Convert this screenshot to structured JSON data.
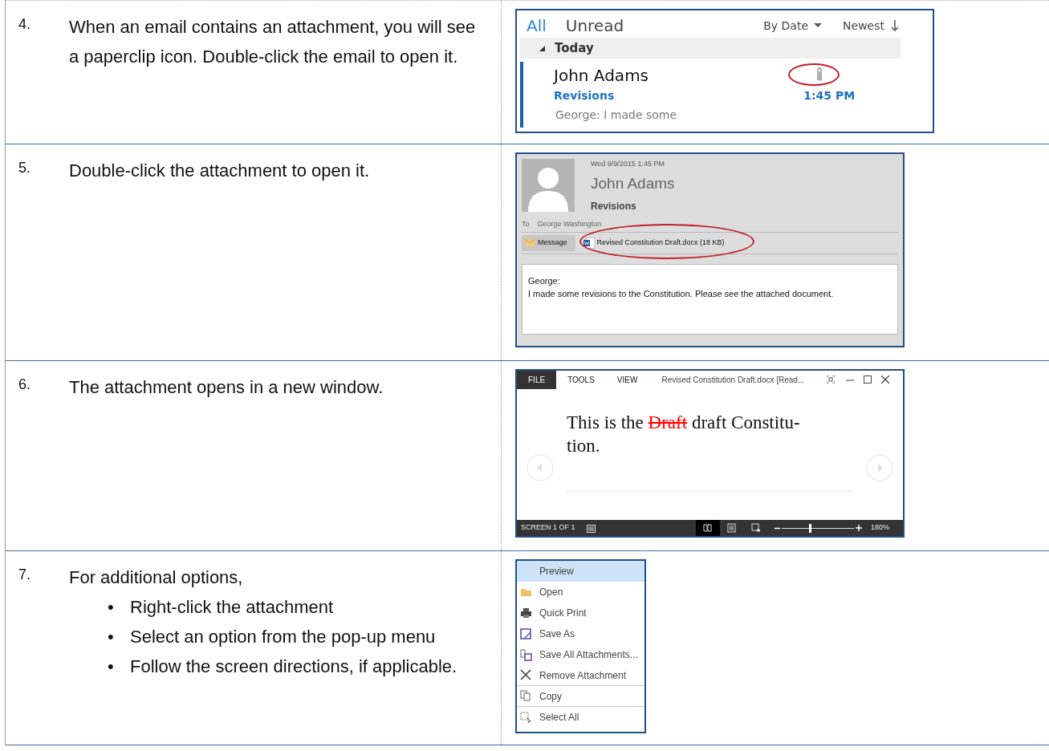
{
  "steps": [
    {
      "number": "4.",
      "text": "When an email contains an attachment, you will see a paperclip icon. Double-click the email to open it.",
      "figure": {
        "kind": "inbox",
        "filters": [
          {
            "label": "All",
            "selected": true
          },
          {
            "label": "Unread",
            "selected": false
          }
        ],
        "sort": "By Date",
        "order": "Newest",
        "group": "Today",
        "email": {
          "sender": "John Adams",
          "subject": "Revisions",
          "time": "1:45 PM",
          "preview": "George:  I made some",
          "has_attachment": true
        }
      }
    },
    {
      "number": "5.",
      "text": "Double-click the attachment to open it.",
      "figure": {
        "kind": "message",
        "date": "Wed 9/9/2015 1:45 PM",
        "sender": "John Adams",
        "subject": "Revisions",
        "to_label": "To",
        "to": "George Washington",
        "message_tab": "Message",
        "attachment": "Revised Constitution Draft.docx (18 KB)",
        "body": [
          "George:",
          "I made some revisions to the Constitution. Please see the attached document."
        ]
      }
    },
    {
      "number": "6.",
      "text": "The attachment opens in a new window.",
      "figure": {
        "kind": "reader",
        "tabs": [
          {
            "label": "FILE",
            "selected": true
          },
          {
            "label": "TOOLS",
            "selected": false
          },
          {
            "label": "VIEW",
            "selected": false
          }
        ],
        "title": "Revised Constitution Draft.docx [Read...",
        "doc_lines": [
          [
            {
              "text": "This is the ",
              "deleted": false
            },
            {
              "text": "Draft",
              "deleted": true
            },
            {
              "text": " draft Constitu-",
              "deleted": false
            }
          ],
          [
            {
              "text": "tion.",
              "deleted": false
            }
          ]
        ],
        "page_status": "SCREEN 1 OF 1",
        "views": [
          {
            "kind": "read",
            "selected": true
          },
          {
            "kind": "print",
            "selected": false
          },
          {
            "kind": "web",
            "selected": false
          }
        ],
        "zoom": {
          "level": 0.39,
          "reading": "180%"
        }
      }
    },
    {
      "number": "7.",
      "text": "For additional options,",
      "bullets": [
        {
          "marker": "•",
          "text": "Right-click the attachment"
        },
        {
          "marker": "•",
          "text": "Select an option from the pop-up menu"
        },
        {
          "marker": "•",
          "text": "Follow the screen directions, if applicable."
        }
      ],
      "figure": {
        "kind": "menu",
        "items": [
          {
            "label": "Preview",
            "kind": "plain",
            "selected": true,
            "separator": false
          },
          {
            "label": "Open",
            "kind": "folder",
            "selected": false,
            "separator": false
          },
          {
            "label": "Quick Print",
            "kind": "printer",
            "selected": false,
            "separator": false
          },
          {
            "label": "Save As",
            "kind": "save",
            "selected": false,
            "separator": false
          },
          {
            "label": "Save All Attachments...",
            "kind": "saveall",
            "selected": false,
            "separator": false
          },
          {
            "label": "Remove Attachment",
            "kind": "remove",
            "selected": false,
            "separator": true
          },
          {
            "label": "Copy",
            "kind": "copy",
            "selected": false,
            "separator": true
          },
          {
            "label": "Select All",
            "kind": "select",
            "selected": false,
            "separator": false
          }
        ]
      }
    }
  ]
}
